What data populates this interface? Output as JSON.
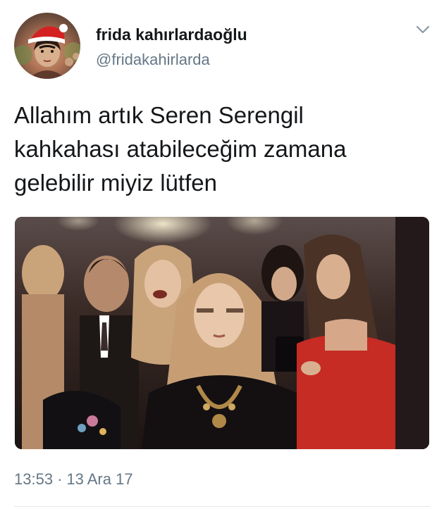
{
  "author": {
    "display_name": "frida kahırlardaoğlu",
    "handle": "@fridakahirlarda",
    "avatar_icon": "avatar-frida-with-santa-hat"
  },
  "menu": {
    "icon": "chevron-down-icon"
  },
  "tweet": {
    "lines": [
      "Allahım artık Seren Serengil",
      "kahkahası atabileceğim zamana",
      "gelebilir miyiz lütfen"
    ]
  },
  "media": {
    "icon": "photo-party-crowd",
    "colors": {
      "background": "#2a1d1a",
      "dress": "#c62b24",
      "hair": "#c9a37a"
    }
  },
  "meta": {
    "time": "13:53",
    "separator": "·",
    "date": "13 Ara 17"
  },
  "colors": {
    "text": "#14171a",
    "secondary": "#657786",
    "divider": "#e1e8ed"
  }
}
